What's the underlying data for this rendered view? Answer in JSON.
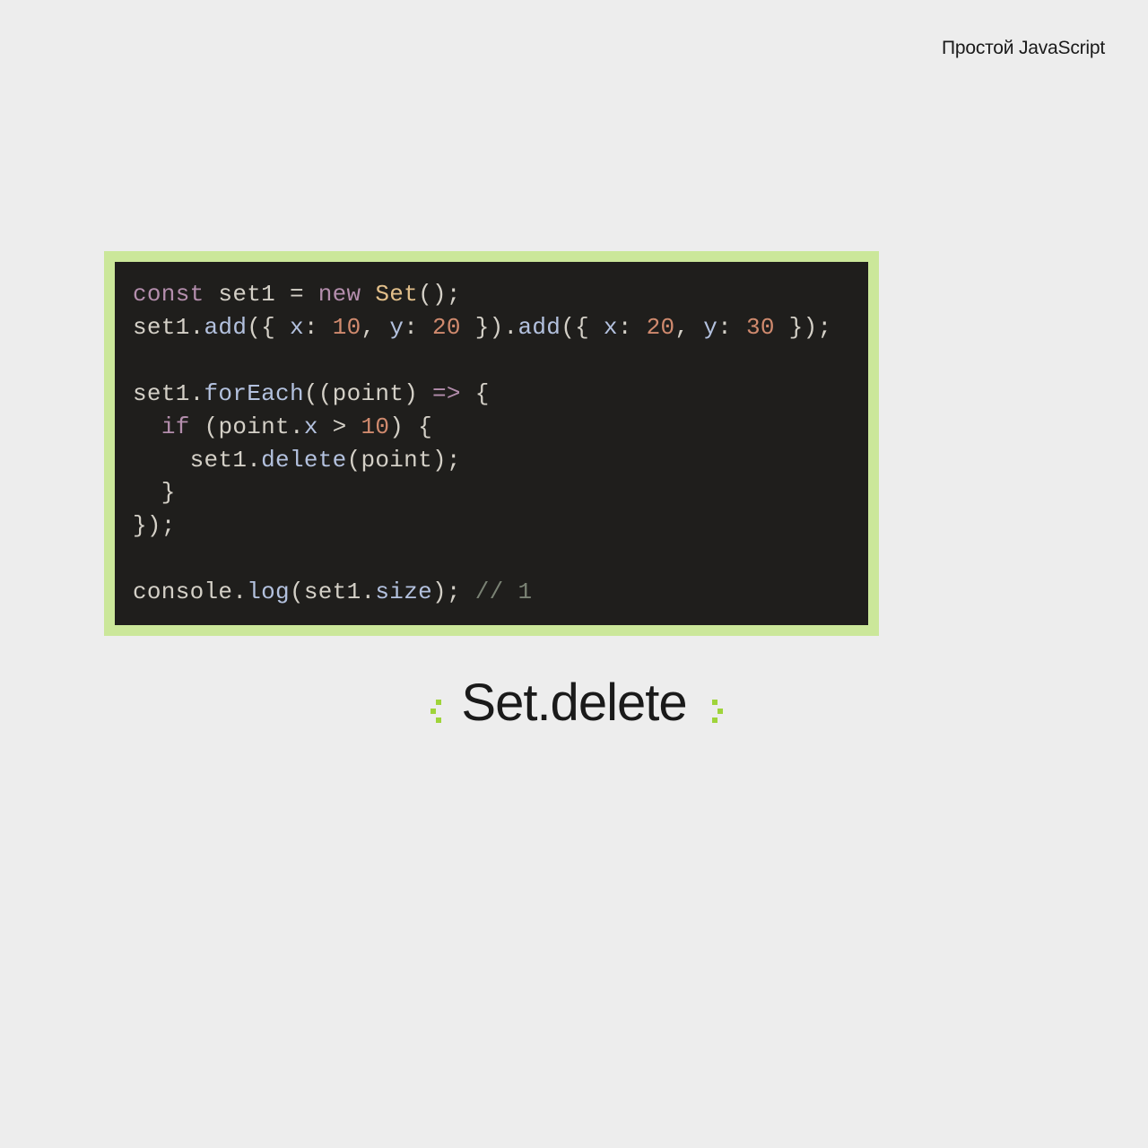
{
  "header": {
    "brand": "Простой JavaScript"
  },
  "code": {
    "lines": [
      {
        "segments": [
          {
            "t": "const ",
            "c": "kw"
          },
          {
            "t": "set1 ",
            "c": "var"
          },
          {
            "t": "= ",
            "c": "op"
          },
          {
            "t": "new ",
            "c": "kw"
          },
          {
            "t": "Set",
            "c": "cls"
          },
          {
            "t": "();",
            "c": "punc"
          }
        ]
      },
      {
        "segments": [
          {
            "t": "set1",
            "c": "var"
          },
          {
            "t": ".",
            "c": "dot"
          },
          {
            "t": "add",
            "c": "fn"
          },
          {
            "t": "({ ",
            "c": "punc"
          },
          {
            "t": "x",
            "c": "fn"
          },
          {
            "t": ": ",
            "c": "punc"
          },
          {
            "t": "10",
            "c": "num"
          },
          {
            "t": ", ",
            "c": "punc"
          },
          {
            "t": "y",
            "c": "fn"
          },
          {
            "t": ": ",
            "c": "punc"
          },
          {
            "t": "20",
            "c": "num"
          },
          {
            "t": " }).",
            "c": "punc"
          },
          {
            "t": "add",
            "c": "fn"
          },
          {
            "t": "({ ",
            "c": "punc"
          },
          {
            "t": "x",
            "c": "fn"
          },
          {
            "t": ": ",
            "c": "punc"
          },
          {
            "t": "20",
            "c": "num"
          },
          {
            "t": ", ",
            "c": "punc"
          },
          {
            "t": "y",
            "c": "fn"
          },
          {
            "t": ": ",
            "c": "punc"
          },
          {
            "t": "30",
            "c": "num"
          },
          {
            "t": " });",
            "c": "punc"
          }
        ]
      },
      {
        "segments": [
          {
            "t": "",
            "c": "var"
          }
        ]
      },
      {
        "segments": [
          {
            "t": "set1",
            "c": "var"
          },
          {
            "t": ".",
            "c": "dot"
          },
          {
            "t": "forEach",
            "c": "fn"
          },
          {
            "t": "((",
            "c": "punc"
          },
          {
            "t": "point",
            "c": "var"
          },
          {
            "t": ") ",
            "c": "punc"
          },
          {
            "t": "=>",
            "c": "arrow"
          },
          {
            "t": " {",
            "c": "punc"
          }
        ]
      },
      {
        "segments": [
          {
            "t": "  ",
            "c": "var"
          },
          {
            "t": "if ",
            "c": "kw"
          },
          {
            "t": "(",
            "c": "punc"
          },
          {
            "t": "point",
            "c": "var"
          },
          {
            "t": ".",
            "c": "dot"
          },
          {
            "t": "x",
            "c": "fn"
          },
          {
            "t": " > ",
            "c": "op"
          },
          {
            "t": "10",
            "c": "num"
          },
          {
            "t": ") {",
            "c": "punc"
          }
        ]
      },
      {
        "segments": [
          {
            "t": "    set1",
            "c": "var"
          },
          {
            "t": ".",
            "c": "dot"
          },
          {
            "t": "delete",
            "c": "fn"
          },
          {
            "t": "(",
            "c": "punc"
          },
          {
            "t": "point",
            "c": "var"
          },
          {
            "t": ");",
            "c": "punc"
          }
        ]
      },
      {
        "segments": [
          {
            "t": "  }",
            "c": "punc"
          }
        ]
      },
      {
        "segments": [
          {
            "t": "});",
            "c": "punc"
          }
        ]
      },
      {
        "segments": [
          {
            "t": "",
            "c": "var"
          }
        ]
      },
      {
        "segments": [
          {
            "t": "console",
            "c": "var"
          },
          {
            "t": ".",
            "c": "dot"
          },
          {
            "t": "log",
            "c": "fn"
          },
          {
            "t": "(",
            "c": "punc"
          },
          {
            "t": "set1",
            "c": "var"
          },
          {
            "t": ".",
            "c": "dot"
          },
          {
            "t": "size",
            "c": "fn"
          },
          {
            "t": "); ",
            "c": "punc"
          },
          {
            "t": "// 1",
            "c": "cmt"
          }
        ]
      }
    ]
  },
  "title": {
    "text": "Set.delete"
  }
}
